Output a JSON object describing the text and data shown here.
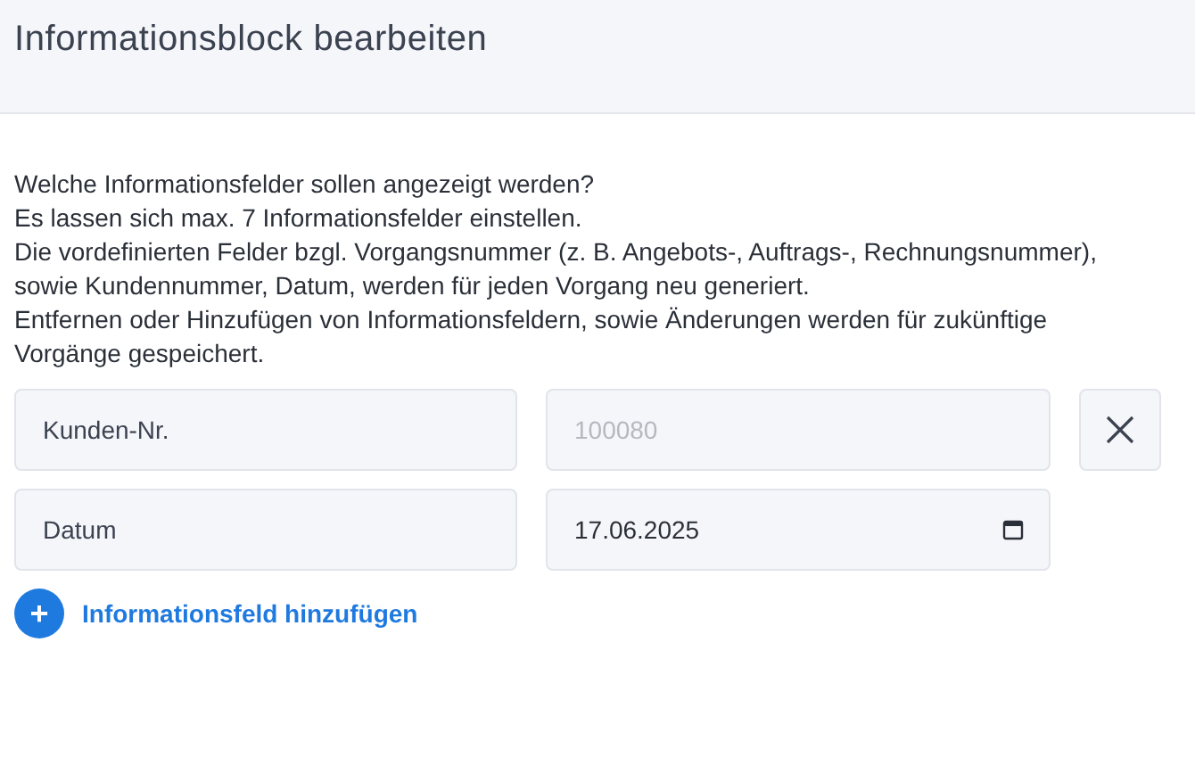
{
  "header": {
    "title": "Informationsblock bearbeiten"
  },
  "intro_lines": [
    "Welche Informationsfelder sollen angezeigt werden?",
    "Es lassen sich max. 7 Informationsfelder einstellen.",
    "Die vordefinierten Felder bzgl. Vorgangsnummer (z. B. Angebots-, Auftrags-, Rechnungsnummer), sowie Kundennummer, Datum, werden für jeden Vorgang neu generiert.",
    "Entfernen oder Hinzufügen von Informationsfeldern, sowie Änderungen werden für zukünftige Vorgänge gespeichert."
  ],
  "fields": [
    {
      "label": "Kunden-Nr.",
      "kind": "text",
      "value": "100080",
      "disabled": true,
      "removable": true
    },
    {
      "label": "Datum",
      "kind": "date",
      "value": "17.06.2025",
      "disabled": false,
      "removable": false
    }
  ],
  "add_button": {
    "icon": "+",
    "label": "Informationsfeld hinzufügen"
  }
}
